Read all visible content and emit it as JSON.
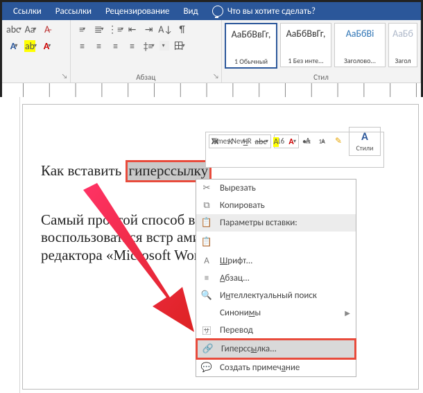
{
  "tabs": [
    "Ссылки",
    "Рассылки",
    "Рецензирование",
    "Вид"
  ],
  "tellme": "Что вы хотите сделать?",
  "groups": {
    "paragraph": "Абзац",
    "styles": "Стил"
  },
  "styles": [
    {
      "preview": "АаБбВвГг,",
      "caption": "1 Обычный",
      "selected": true
    },
    {
      "preview": "АаБбВвГг,",
      "caption": "1 Без инте...",
      "selected": false
    },
    {
      "preview": "АаБбВі",
      "caption": "Заголово...",
      "selected": false,
      "light": true
    },
    {
      "preview": "АаБб",
      "caption": "Загол",
      "selected": false,
      "faded": true
    }
  ],
  "document": {
    "line1_pre": "Как вставить ",
    "line1_sel": "гиперссылку",
    "para2": "Самый простой способ вст                                 кумент гипе– это воспользоваться встр                                ами текстово\nредактора «Microsoft Word"
  },
  "mini": {
    "font": "Times New R",
    "size": "16",
    "grow": "A↑",
    "shrink": "A↓",
    "brush": "🖌",
    "stylesLabel": "Стили",
    "bold": "Ж",
    "italic": "К",
    "underline": "Ч",
    "strike": "abc",
    "sub": "A₂",
    "color": "A",
    "bullets": "•",
    "numbers": "1."
  },
  "ctx": {
    "cut": "Вырезать",
    "copy": "Копировать",
    "paste_header": "Параметры вставки:",
    "font": "Шрифт...",
    "para": "Абзац...",
    "smart": "Интеллектуальный поиск",
    "syn": "Синонимы",
    "trans": "Перевод",
    "hyper": "Гиперссылка...",
    "comment": "Создать примечание"
  }
}
